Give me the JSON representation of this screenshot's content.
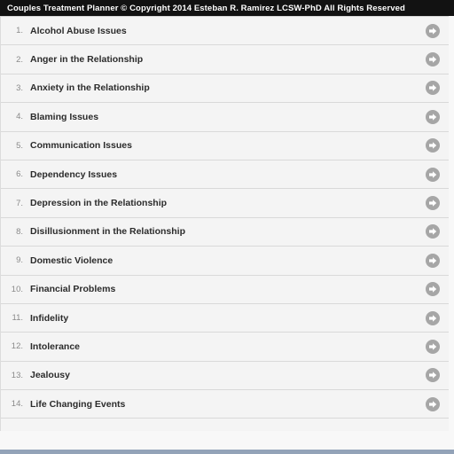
{
  "titlebar": {
    "text": "Couples Treatment Planner © Copyright 2014 Esteban R. Ramirez LCSW-PhD All Rights Reserved"
  },
  "colors": {
    "titlebar_bg": "#121212",
    "titlebar_text": "#ffffff",
    "row_bg": "#f4f4f4",
    "row_divider": "#d9d9d9",
    "label_text": "#2b2b2b",
    "index_text": "#8a8a8a",
    "arrow_circle": "#a6a6a6",
    "arrow_glyph": "#ffffff",
    "system_bar": "#93a3b8",
    "page_bg": "#f8f8f8"
  },
  "list": {
    "icon_name": "arrow-right-circle-icon",
    "items": [
      {
        "index": "1.",
        "label": "Alcohol Abuse Issues"
      },
      {
        "index": "2.",
        "label": "Anger in the Relationship"
      },
      {
        "index": "3.",
        "label": "Anxiety in the Relationship"
      },
      {
        "index": "4.",
        "label": "Blaming Issues"
      },
      {
        "index": "5.",
        "label": "Communication Issues"
      },
      {
        "index": "6.",
        "label": "Dependency Issues"
      },
      {
        "index": "7.",
        "label": "Depression in the Relationship"
      },
      {
        "index": "8.",
        "label": "Disillusionment in the Relationship"
      },
      {
        "index": "9.",
        "label": "Domestic Violence"
      },
      {
        "index": "10.",
        "label": "Financial Problems"
      },
      {
        "index": "11.",
        "label": "Infidelity"
      },
      {
        "index": "12.",
        "label": "Intolerance"
      },
      {
        "index": "13.",
        "label": "Jealousy"
      },
      {
        "index": "14.",
        "label": "Life Changing Events"
      }
    ]
  }
}
